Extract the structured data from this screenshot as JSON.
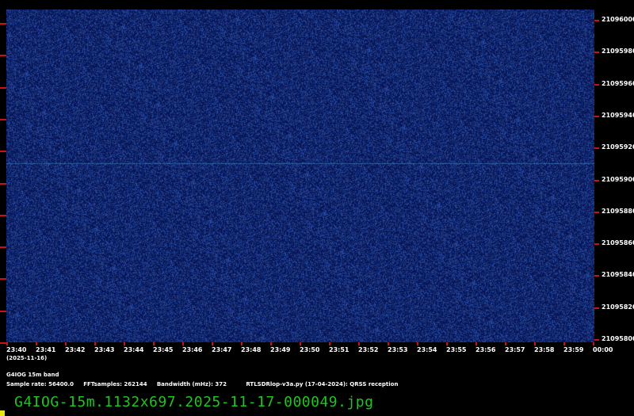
{
  "plot": {
    "freq_labels": [
      "21096000",
      "21095980",
      "21095960",
      "21095940",
      "21095920",
      "21095900",
      "21095880",
      "21095860",
      "21095840",
      "21095820",
      "21095800"
    ],
    "time_labels": [
      "23:40",
      "23:41",
      "23:42",
      "23:43",
      "23:44",
      "23:45",
      "23:46",
      "23:47",
      "23:48",
      "23:49",
      "23:50",
      "23:51",
      "23:52",
      "23:53",
      "23:54",
      "23:55",
      "23:56",
      "23:57",
      "23:58",
      "23:59",
      "00:00"
    ],
    "date_label": "(2025-11-16)",
    "background_color": "#0a1a5c",
    "noise_color": "#2c4aa8",
    "signal_color": "#4a8fc8"
  },
  "footer": {
    "station": "G4IOG 15m band",
    "sample_rate": "Sample rate: 56400.0",
    "fft_samples": "FFTsamples: 262144",
    "bandwidth": "Bandwidth (mHz): 372",
    "software": "RTLSDRlop-v3a.py (17-04-2024): QRSS reception"
  },
  "filename": "G4IOG-15m.1132x697.2025-11-17-000049.jpg"
}
